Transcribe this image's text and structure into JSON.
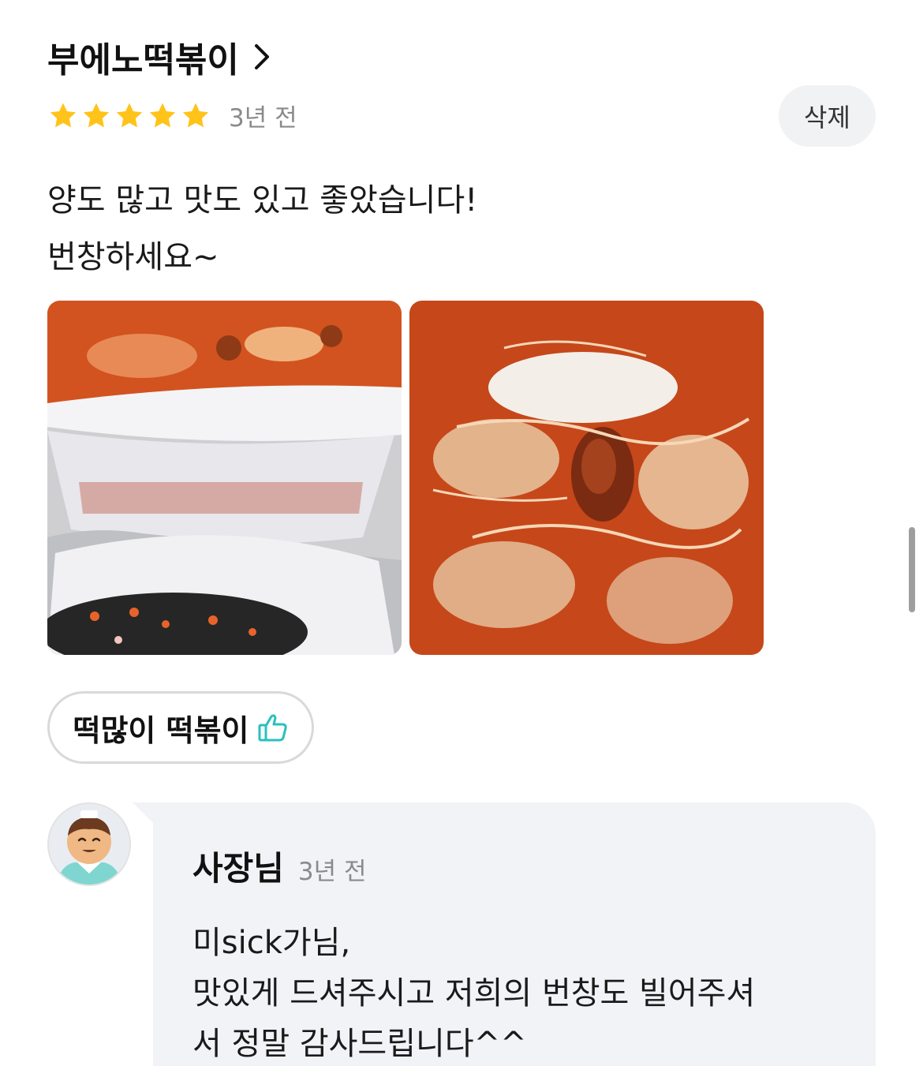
{
  "review": {
    "store_name": "부에노떡볶이",
    "rating": 5,
    "rating_max": 5,
    "time": "3년 전",
    "delete_label": "삭제",
    "text_lines": [
      "양도 많고 맛도 있고 좋았습니다!",
      "번창하세요~"
    ],
    "photo_count": 2,
    "liked_menu": "떡많이 떡볶이"
  },
  "reply": {
    "author": "사장님",
    "time": "3년 전",
    "text_lines": [
      "미sick가님,",
      "맛있게 드셔주시고 저희의 번창도 빌어주셔",
      "서 정말 감사드립니다^^"
    ]
  },
  "colors": {
    "star": "#FFC31A",
    "thumb_icon": "#2AC1BC",
    "bubble_bg": "#F2F3F6",
    "delete_bg": "#F1F2F4"
  },
  "icons": {
    "chevron": "chevron-right-icon",
    "star": "star-icon",
    "like": "thumbs-up-icon"
  }
}
